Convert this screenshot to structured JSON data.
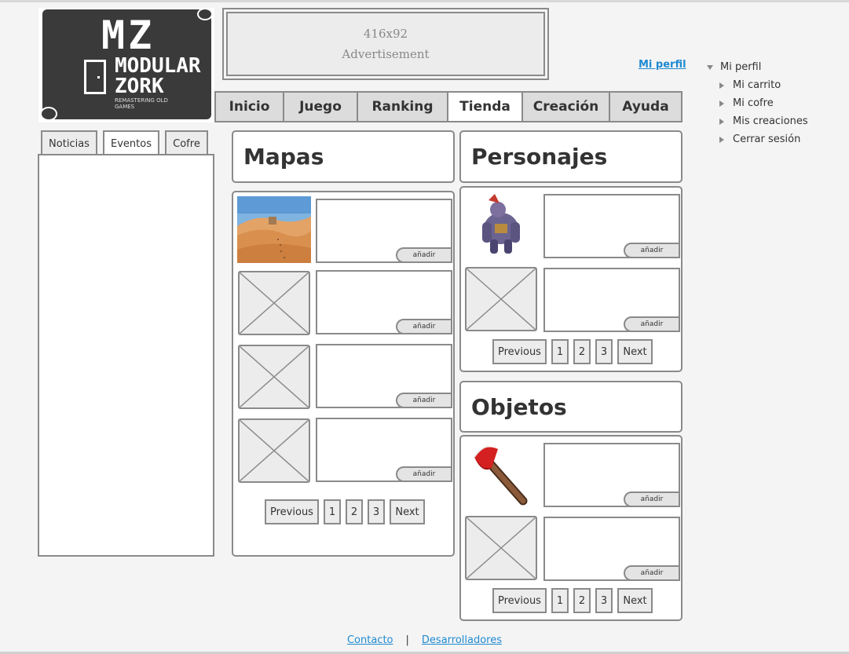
{
  "logo": {
    "title": "MZ",
    "word1": "MODULAR",
    "word2": "ZORK",
    "tagline": "REMASTERING OLD GAMES"
  },
  "ad": {
    "size": "416x92",
    "label": "Advertisement"
  },
  "header": {
    "profile_link": "Mi perfil"
  },
  "user_menu": {
    "root": "Mi perfil",
    "items": [
      {
        "label": "Mi carrito"
      },
      {
        "label": "Mi cofre"
      },
      {
        "label": "Mis creaciones"
      },
      {
        "label": "Cerrar sesión"
      }
    ]
  },
  "nav": {
    "tabs": [
      {
        "label": "Inicio",
        "active": false
      },
      {
        "label": "Juego",
        "active": false
      },
      {
        "label": "Ranking",
        "active": false
      },
      {
        "label": "Tienda",
        "active": true
      },
      {
        "label": "Creación",
        "active": false
      },
      {
        "label": "Ayuda",
        "active": false
      }
    ]
  },
  "left_tabs": [
    {
      "label": "Noticias"
    },
    {
      "label": "Eventos"
    },
    {
      "label": "Cofre"
    }
  ],
  "sections": {
    "mapas": {
      "title": "Mapas"
    },
    "personajes": {
      "title": "Personajes"
    },
    "objetos": {
      "title": "Objetos"
    }
  },
  "add_label": "añadir",
  "pager": {
    "prev": "Previous",
    "next": "Next",
    "pages": [
      "1",
      "2",
      "3"
    ]
  },
  "footer": {
    "contact": "Contacto",
    "separator": "|",
    "developers": "Desarrolladores"
  }
}
